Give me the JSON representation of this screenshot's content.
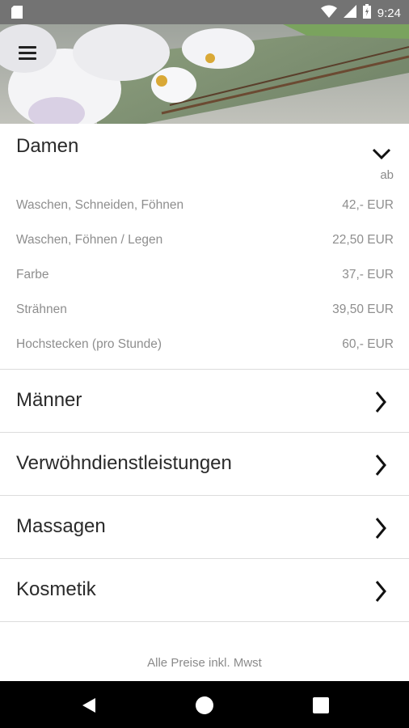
{
  "status_bar": {
    "time": "9:24",
    "icons": [
      "sim-card-icon",
      "wifi-icon",
      "signal-icon",
      "battery-charging-icon"
    ]
  },
  "header": {
    "menu_icon": "hamburger-menu-icon"
  },
  "sections": [
    {
      "title": "Damen",
      "expanded": true,
      "price_prefix": "ab",
      "items": [
        {
          "name": "Waschen, Schneiden, Föhnen",
          "price": "42,- EUR"
        },
        {
          "name": "Waschen, Föhnen / Legen",
          "price": "22,50 EUR"
        },
        {
          "name": "Farbe",
          "price": "37,- EUR"
        },
        {
          "name": "Strähnen",
          "price": "39,50 EUR"
        },
        {
          "name": "Hochstecken (pro Stunde)",
          "price": "60,- EUR"
        }
      ]
    },
    {
      "title": "Männer",
      "expanded": false
    },
    {
      "title": "Verwöhndienstleistungen",
      "expanded": false
    },
    {
      "title": "Massagen",
      "expanded": false
    },
    {
      "title": "Kosmetik",
      "expanded": false
    }
  ],
  "footer_note": "Alle Preise inkl. Mwst",
  "nav_bar": {
    "buttons": [
      "back-icon",
      "home-icon",
      "recents-icon"
    ]
  }
}
